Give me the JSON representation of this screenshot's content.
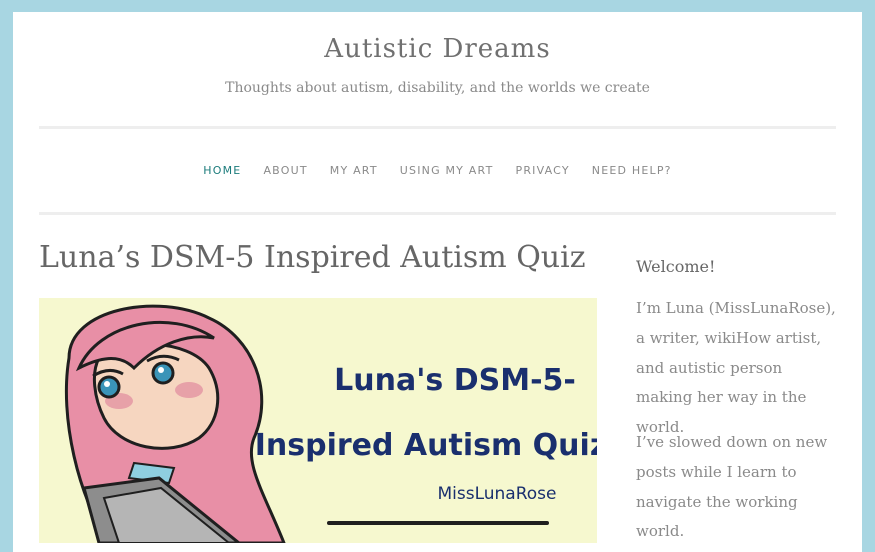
{
  "header": {
    "site_title": "Autistic Dreams",
    "tagline": "Thoughts about autism, disability, and the worlds we create"
  },
  "nav": {
    "items": [
      {
        "label": "HOME",
        "active": true
      },
      {
        "label": "ABOUT"
      },
      {
        "label": "MY ART"
      },
      {
        "label": "USING MY ART"
      },
      {
        "label": "PRIVACY"
      },
      {
        "label": "NEED HELP?"
      }
    ]
  },
  "post": {
    "title": "Luna’s DSM-5 Inspired Autism Quiz",
    "image": {
      "line1": "Luna's DSM-5-",
      "line2": "Inspired Autism Quiz",
      "credit": "MissLunaRose"
    }
  },
  "sidebar": {
    "widget_title": "Welcome!",
    "paragraphs": [
      "I’m Luna (MissLunaRose), a writer, wikiHow artist, and autistic person making her way in the world.",
      "I’ve slowed down on new posts while I learn to navigate the working world."
    ]
  },
  "colors": {
    "background": "#a8d6e2",
    "accent": "#1c7c7c",
    "image_bg": "#f6f8cf",
    "image_text": "#1a2f6e",
    "hair": "#e88fa6"
  }
}
